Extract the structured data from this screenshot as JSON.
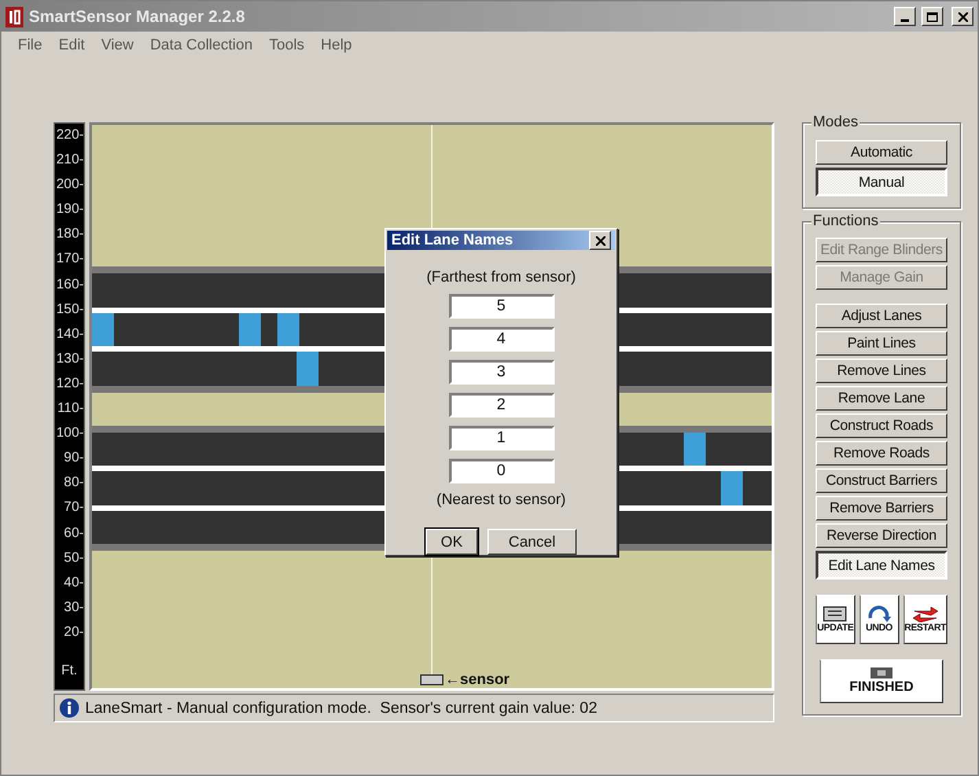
{
  "window": {
    "title": "SmartSensor Manager 2.2.8"
  },
  "menu": [
    "File",
    "Edit",
    "View",
    "Data Collection",
    "Tools",
    "Help"
  ],
  "axis": {
    "labels": [
      "220-",
      "210-",
      "200-",
      "190-",
      "180-",
      "170-",
      "160-",
      "150-",
      "140-",
      "130-",
      "120-",
      "110-",
      "100-",
      "90-",
      "80-",
      "70-",
      "60-",
      "50-",
      "40-",
      "30-",
      "20-"
    ],
    "unit": "Ft."
  },
  "roads": [
    {
      "lanes": [
        {
          "kind": "lane"
        },
        {
          "kind": "lane",
          "vehicles": [
            {
              "level": 0
            },
            {
              "level": 0.216
            },
            {
              "level": 0.272
            }
          ]
        },
        {
          "kind": "lane",
          "vehicles": [
            {
              "level": 0.302
            }
          ]
        }
      ]
    },
    {
      "lanes": [
        {
          "kind": "lane",
          "vehicles": [
            {
              "level": 0.871
            }
          ]
        },
        {
          "kind": "lane",
          "vehicles": [
            {
              "level": 0.925
            }
          ]
        },
        {
          "kind": "lane"
        }
      ]
    }
  ],
  "sensor": {
    "label": "←sensor"
  },
  "status_bar": {
    "text": "LaneSmart - Manual configuration mode.  Sensor's current gain value: 02"
  },
  "modes": {
    "title": "Modes",
    "items": [
      {
        "label": "Automatic",
        "selected": false
      },
      {
        "label": "Manual",
        "selected": true
      }
    ]
  },
  "functions": {
    "title": "Functions",
    "groups": [
      {
        "items": [
          {
            "label": "Edit Range Blinders",
            "disabled": true,
            "selected": false
          },
          {
            "label": "Manage Gain",
            "disabled": true,
            "selected": false
          }
        ]
      },
      {
        "items": [
          {
            "label": "Adjust Lanes",
            "disabled": false,
            "selected": false
          },
          {
            "label": "Paint Lines",
            "disabled": false,
            "selected": false
          },
          {
            "label": "Remove Lines",
            "disabled": false,
            "selected": false
          },
          {
            "label": "Remove Lane",
            "disabled": false,
            "selected": false
          },
          {
            "label": "Construct Roads",
            "disabled": false,
            "selected": false
          },
          {
            "label": "Remove Roads",
            "disabled": false,
            "selected": false
          },
          {
            "label": "Construct Barriers",
            "disabled": false,
            "selected": false
          },
          {
            "label": "Remove Barriers",
            "disabled": false,
            "selected": false
          },
          {
            "label": "Reverse Direction",
            "disabled": false,
            "selected": false
          },
          {
            "label": "Edit Lane Names",
            "disabled": false,
            "selected": true
          }
        ]
      }
    ],
    "tools": [
      {
        "label": "UPDATE",
        "kind": "update"
      },
      {
        "label": "UNDO",
        "kind": "undo"
      },
      {
        "label": "RESTART",
        "kind": "restart"
      }
    ],
    "finish": {
      "label": "FINISHED"
    }
  },
  "dialog": {
    "title": "Edit Lane Names",
    "top_note": "(Farthest from sensor)",
    "fields": [
      "5",
      "4",
      "3",
      "2",
      "1",
      "0"
    ],
    "bottom_note": "(Nearest to sensor)",
    "buttons": [
      {
        "label": "OK",
        "default": true
      },
      {
        "label": "Cancel",
        "default": false
      }
    ]
  }
}
